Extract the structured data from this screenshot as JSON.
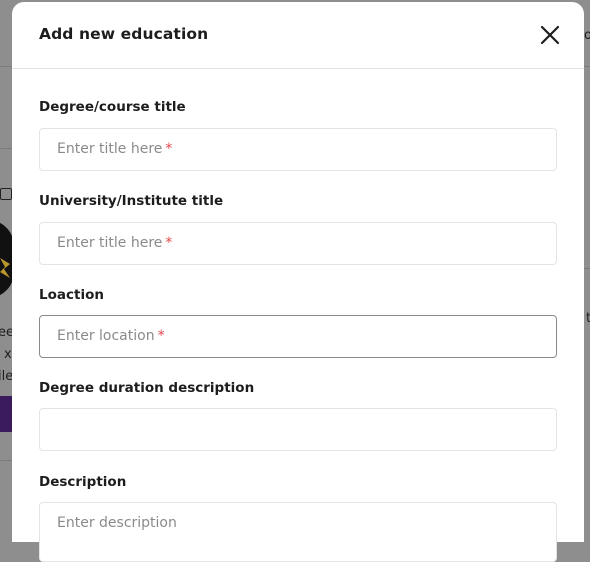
{
  "modal": {
    "title": "Add new education",
    "close_icon": "close-icon"
  },
  "form": {
    "degree": {
      "label": "Degree/course title",
      "placeholder": "Enter title here",
      "required_mark": "*"
    },
    "university": {
      "label": "University/Institute title",
      "placeholder": "Enter title here",
      "required_mark": "*"
    },
    "location": {
      "label": "Loaction",
      "placeholder": "Enter location",
      "required_mark": "*"
    },
    "duration": {
      "label": "Degree duration description",
      "placeholder": ""
    },
    "description": {
      "label": "Description",
      "placeholder": "Enter description"
    }
  },
  "background": {
    "right_top": "on",
    "right_mid": "t",
    "left_1": "ee",
    "left_2": "x",
    "left_3": "ile"
  },
  "colors": {
    "overlay": "#8e8e8e",
    "required": "#e5484d",
    "accent_purple": "#3b1a5e"
  }
}
